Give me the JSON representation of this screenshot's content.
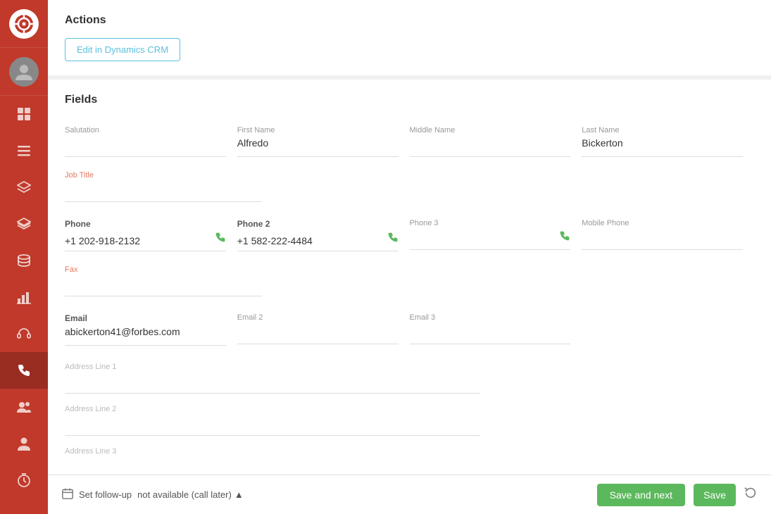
{
  "sidebar": {
    "logo_icon": "🎬",
    "items": [
      {
        "id": "dashboard",
        "icon": "⊞",
        "active": false
      },
      {
        "id": "inbox",
        "icon": "☰",
        "active": false
      },
      {
        "id": "layers",
        "icon": "◧",
        "active": false
      },
      {
        "id": "stack",
        "icon": "⬡",
        "active": false
      },
      {
        "id": "database",
        "icon": "⬡",
        "active": false
      },
      {
        "id": "chart",
        "icon": "📊",
        "active": false
      },
      {
        "id": "headset",
        "icon": "🎧",
        "active": false
      },
      {
        "id": "phone",
        "icon": "📞",
        "active": true
      },
      {
        "id": "contacts",
        "icon": "👥",
        "active": false
      },
      {
        "id": "user",
        "icon": "👤",
        "active": false
      },
      {
        "id": "timer",
        "icon": "⏱",
        "active": false
      }
    ]
  },
  "actions": {
    "section_title": "Actions",
    "edit_crm_btn": "Edit in Dynamics CRM"
  },
  "fields": {
    "section_title": "Fields",
    "salutation": {
      "label": "Salutation",
      "value": ""
    },
    "first_name": {
      "label": "First Name",
      "value": "Alfredo"
    },
    "middle_name": {
      "label": "Middle Name",
      "value": ""
    },
    "last_name": {
      "label": "Last Name",
      "value": "Bickerton"
    },
    "job_title": {
      "label": "Job Title",
      "value": ""
    },
    "phone": {
      "label": "Phone",
      "value": "+1 202-918-2132"
    },
    "phone2": {
      "label": "Phone 2",
      "value": "+1 582-222-4484"
    },
    "phone3": {
      "label": "Phone 3",
      "value": ""
    },
    "mobile_phone": {
      "label": "Mobile Phone",
      "value": ""
    },
    "fax": {
      "label": "Fax",
      "value": ""
    },
    "email": {
      "label": "Email",
      "value": "abickerton41@forbes.com"
    },
    "email2": {
      "label": "Email 2",
      "value": ""
    },
    "email3": {
      "label": "Email 3",
      "value": ""
    },
    "address_line1": {
      "label": "Address Line 1",
      "value": ""
    },
    "address_line2": {
      "label": "Address Line 2",
      "value": ""
    },
    "address_line3": {
      "label": "Address Line 3",
      "value": ""
    }
  },
  "footer": {
    "set_follow_up": "Set follow-up",
    "follow_up_status": "not available (call later)",
    "save_and_next": "Save and next",
    "save": "Save"
  }
}
